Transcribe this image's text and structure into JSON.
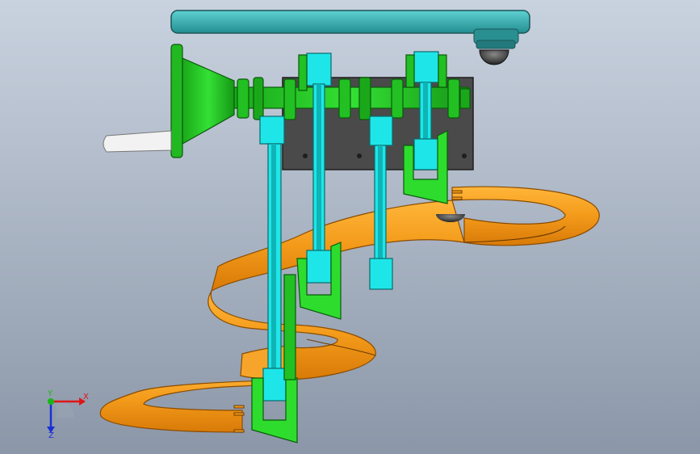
{
  "viewport": {
    "background_top": "#c9d2df",
    "background_bottom": "#8b97a8"
  },
  "model": {
    "colors": {
      "spiral_track": "#f39a1a",
      "link_rods": "#1ee6e8",
      "crank_gears": "#1ec81e",
      "base_plate": "#4a4a4a",
      "top_beam": "#2aa7a9",
      "handle": "#f2f2f2"
    }
  },
  "triad": {
    "x_label": "X",
    "y_label": "Y",
    "z_label": "Z",
    "x_color": "#e01616",
    "y_color": "#16b816",
    "z_color": "#1a2fd6"
  }
}
